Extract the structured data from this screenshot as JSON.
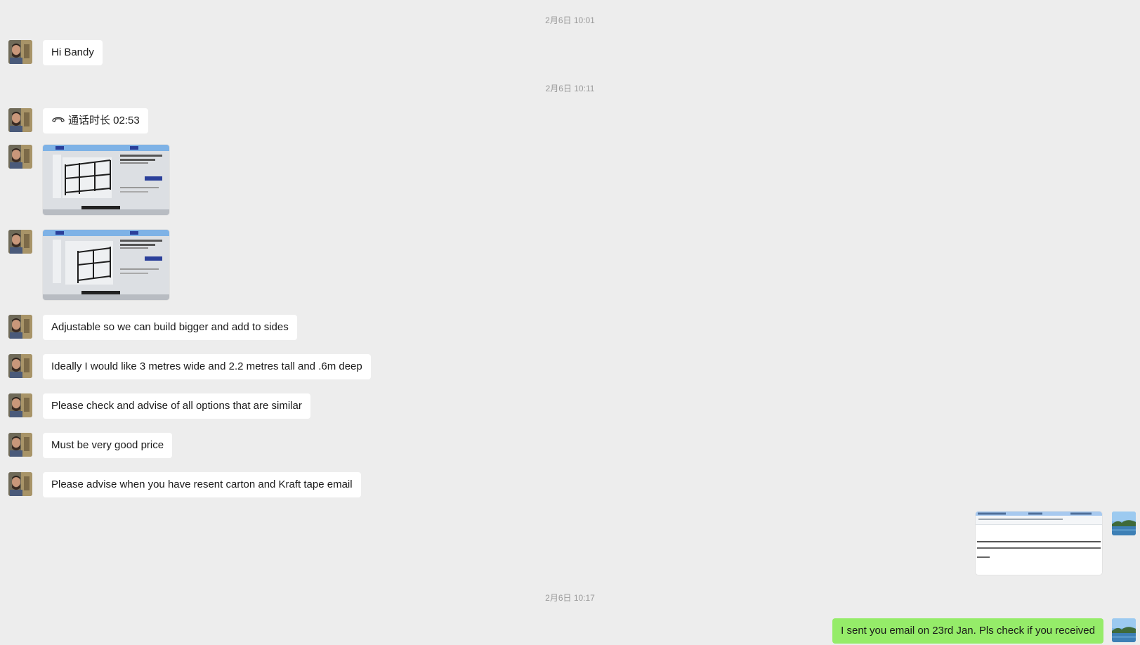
{
  "timestamps": [
    "2月6日 10:01",
    "2月6日 10:11",
    "2月6日 10:17"
  ],
  "messages": {
    "hi": "Hi Bandy",
    "call_duration": "通话时长 02:53",
    "adjustable": "Adjustable so we can build bigger and add to sides",
    "ideally": "Ideally I would like 3 metres wide and 2.2 metres tall and .6m deep",
    "check_options": "Please check and advise of all options that are similar",
    "good_price": "Must be very good price",
    "resent": "Please advise when you have resent carton and Kraft tape email",
    "sent_email": "I sent you email on 23rd Jan. Pls check if you received"
  },
  "icons": {
    "call": "phone-handset-icon",
    "contact_avatar": "contact-photo-avatar",
    "my_avatar": "lake-landscape-avatar"
  },
  "colors": {
    "background": "#ededed",
    "incoming_bubble": "#ffffff",
    "outgoing_bubble": "#95ec69",
    "timestamp_text": "#9a9a9a"
  }
}
